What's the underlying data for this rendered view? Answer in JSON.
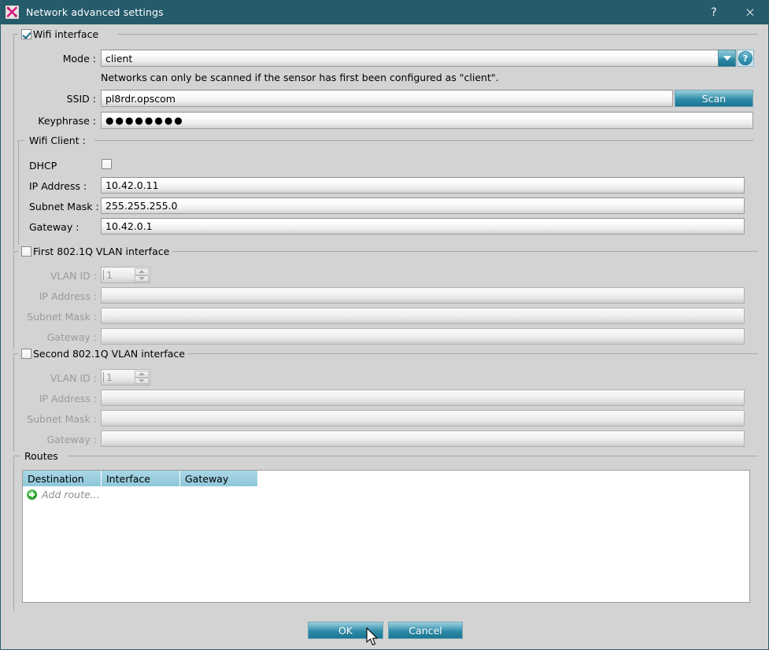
{
  "window": {
    "title": "Network advanced settings",
    "icon": "tools-icon",
    "help_label": "?",
    "close_label": "×",
    "accent_color": "#255b6b",
    "body_color": "#d3d3d3"
  },
  "wifi": {
    "group_label": "Wifi interface",
    "enabled": true,
    "mode_label": "Mode :",
    "mode_value": "client",
    "mode_hint": "Networks can only be scanned if the sensor has first been configured as \"client\".",
    "ssid_label": "SSID :",
    "ssid_value": "pl8rdr.opscom",
    "scan_label": "Scan",
    "keyphrase_label": "Keyphrase :",
    "keyphrase_value": "●●●●●●●●"
  },
  "wifi_client": {
    "group_label": "Wifi Client :",
    "dhcp_label": "DHCP",
    "dhcp_checked": false,
    "ip_label": "IP Address :",
    "ip_value": "10.42.0.11",
    "mask_label": "Subnet Mask :",
    "mask_value": "255.255.255.0",
    "gateway_label": "Gateway :",
    "gateway_value": "10.42.0.1"
  },
  "vlan1": {
    "group_label": "First 802.1Q VLAN interface",
    "enabled": false,
    "vlan_id_label": "VLAN ID :",
    "vlan_id_value": "1",
    "ip_label": "IP Address :",
    "ip_value": "",
    "mask_label": "Subnet Mask :",
    "mask_value": "",
    "gateway_label": "Gateway :",
    "gateway_value": ""
  },
  "vlan2": {
    "group_label": "Second 802.1Q VLAN interface",
    "enabled": false,
    "vlan_id_label": "VLAN ID :",
    "vlan_id_value": "1",
    "ip_label": "IP Address :",
    "ip_value": "",
    "mask_label": "Subnet Mask :",
    "mask_value": "",
    "gateway_label": "Gateway :",
    "gateway_value": ""
  },
  "routes": {
    "group_label": "Routes",
    "columns": [
      "Destination",
      "Interface",
      "Gateway"
    ],
    "rows": [],
    "add_row_label": "Add route...",
    "add_row_icon": "plus-circle-icon"
  },
  "footer": {
    "ok_label": "OK",
    "cancel_label": "Cancel"
  }
}
